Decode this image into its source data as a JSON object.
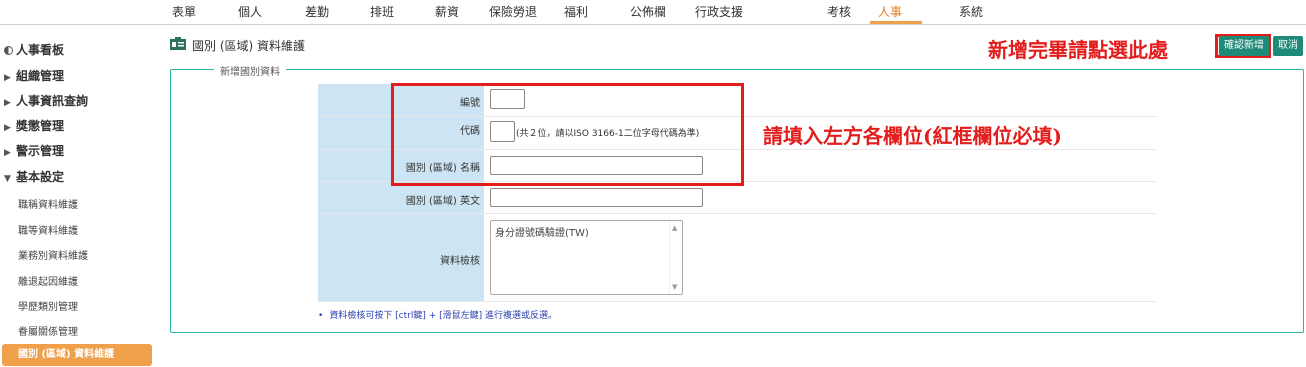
{
  "nav": {
    "items": [
      {
        "label": "表單",
        "active": false
      },
      {
        "label": "個人",
        "active": false
      },
      {
        "label": "差勤",
        "active": false
      },
      {
        "label": "排班",
        "active": false
      },
      {
        "label": "薪資",
        "active": false
      },
      {
        "label": "保險勞退",
        "active": false
      },
      {
        "label": "福利",
        "active": false
      },
      {
        "label": "公佈欄",
        "active": false
      },
      {
        "label": "行政支援",
        "active": false
      },
      {
        "label": "考核",
        "active": false
      },
      {
        "label": "人事",
        "active": true
      },
      {
        "label": "系統",
        "active": false
      }
    ],
    "active_color": "#e67e22"
  },
  "sidebar": {
    "items": [
      {
        "label": "人事看板"
      },
      {
        "label": "組織管理"
      },
      {
        "label": "人事資訊查詢"
      },
      {
        "label": "獎懲管理"
      },
      {
        "label": "警示管理"
      },
      {
        "label": "基本設定",
        "expanded": true
      }
    ],
    "sub_items": [
      {
        "label": "職稱資料維護"
      },
      {
        "label": "職等資料維護"
      },
      {
        "label": "業務別資料維護"
      },
      {
        "label": "離退起因維護"
      },
      {
        "label": "學歷類別管理"
      },
      {
        "label": "眷屬關係管理"
      }
    ],
    "active_sub": "國別 (區域) 資料維護",
    "active_color": "#f0a04b"
  },
  "header": {
    "title": "國別 (區域) 資料維護",
    "icon": "id-card-icon"
  },
  "annotations": {
    "note_top": "新增完畢請點選此處",
    "note_form": "請填入左方各欄位(紅框欄位必填)",
    "color": "#e31c1c"
  },
  "buttons": {
    "confirm": "確認新增",
    "cancel": "取消",
    "color": "#1f8a78"
  },
  "form": {
    "legend": "新增國別資料",
    "fields": {
      "number_label": "編號",
      "number_value": "",
      "code_label": "代碼",
      "code_value": "",
      "code_hint": "(共２位，請以ISO 3166-1二位字母代碼為準)",
      "name_label": "國別 (區域) 名稱",
      "name_value": "",
      "name_en_label": "國別 (區域) 英文",
      "name_en_value": "",
      "check_label": "資料檢核",
      "check_options": [
        "身分證號碼驗證(TW)"
      ]
    },
    "footnote": "資料檢核可按下 [ctrl鍵] + [滑鼠左鍵] 進行複選或反選。"
  }
}
